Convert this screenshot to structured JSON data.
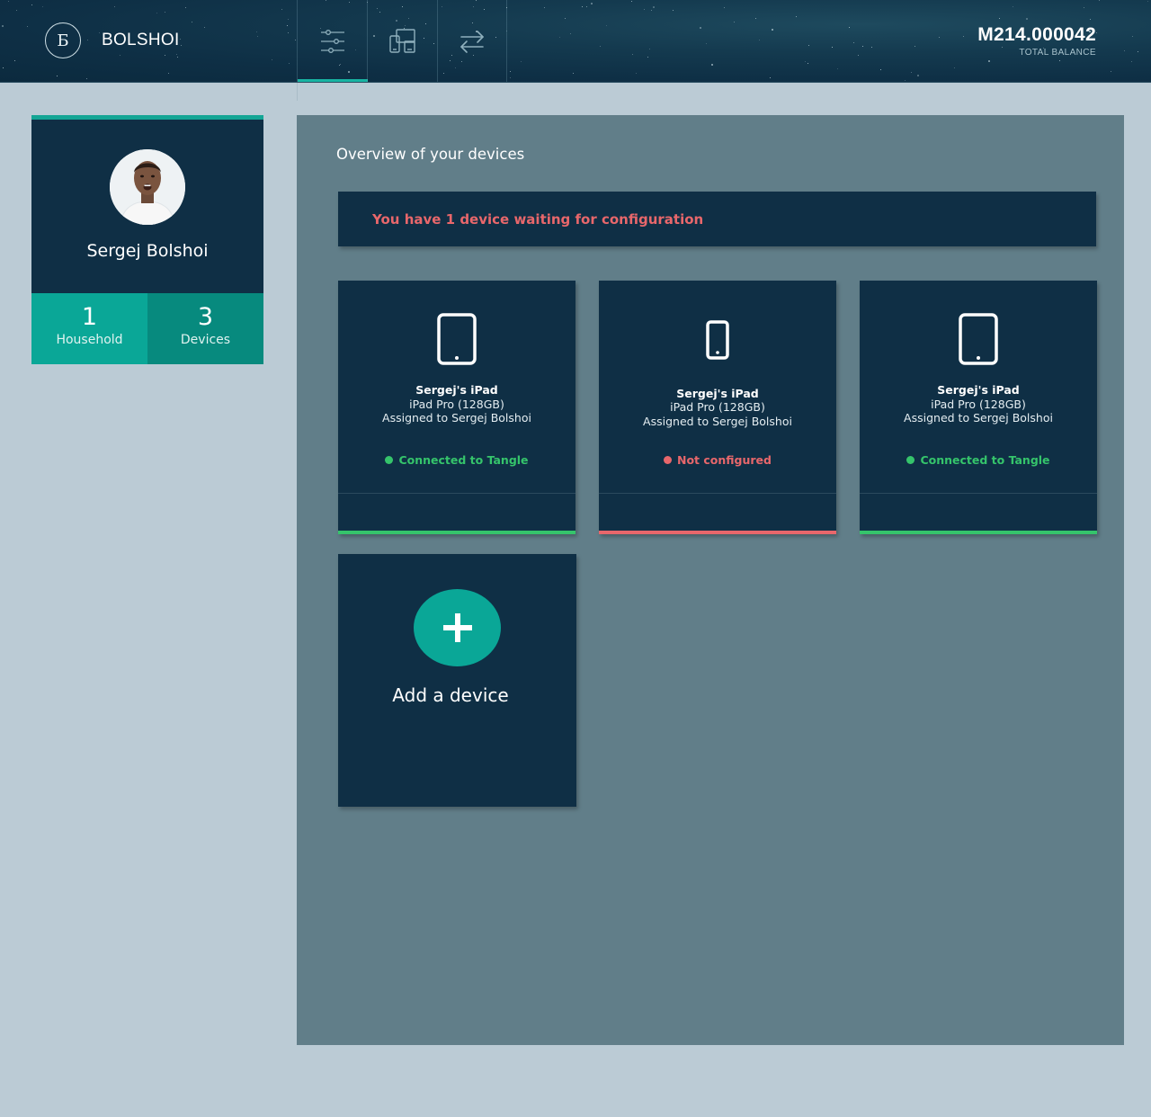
{
  "header": {
    "logo_glyph": "Б",
    "brand": "BOLSHOI",
    "nav": [
      {
        "name": "settings-sliders-icon",
        "active": true
      },
      {
        "name": "devices-icon",
        "active": false
      },
      {
        "name": "transfer-arrows-icon",
        "active": false
      }
    ],
    "balance_amount": "M214.000042",
    "balance_label": "TOTAL BALANCE"
  },
  "profile": {
    "name": "Sergej Bolshoi",
    "stats": [
      {
        "value": "1",
        "label": "Household"
      },
      {
        "value": "3",
        "label": "Devices"
      }
    ]
  },
  "main": {
    "title": "Overview of your devices",
    "alert": "You have 1 device waiting for configuration",
    "devices": [
      {
        "icon": "tablet-icon",
        "name": "Sergej's iPad",
        "model": "iPad Pro (128GB)",
        "assigned": "Assigned to Sergej Bolshoi",
        "status": "Connected to Tangle",
        "status_color": "#35c46b"
      },
      {
        "icon": "phone-icon",
        "name": "Sergej's iPad",
        "model": "iPad Pro (128GB)",
        "assigned": "Assigned to Sergej Bolshoi",
        "status": "Not configured",
        "status_color": "#e8676b"
      },
      {
        "icon": "tablet-icon",
        "name": "Sergej's iPad",
        "model": "iPad Pro (128GB)",
        "assigned": "Assigned to Sergej Bolshoi",
        "status": "Connected to Tangle",
        "status_color": "#35c46b"
      }
    ],
    "add_label": "Add a device"
  },
  "colors": {
    "accent": "#0aa797",
    "card": "#0f2f45",
    "panel": "#617e89",
    "page": "#bbcbd5",
    "ok": "#35c46b",
    "error": "#e8676b"
  }
}
